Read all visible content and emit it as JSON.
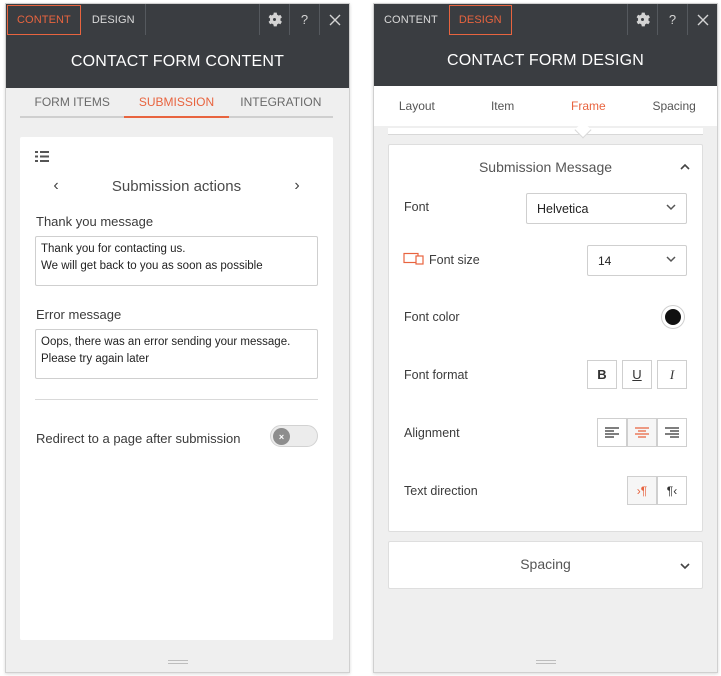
{
  "left": {
    "tabs": [
      "CONTENT",
      "DESIGN"
    ],
    "title": "CONTACT FORM CONTENT",
    "subtabs": [
      "FORM ITEMS",
      "SUBMISSION",
      "INTEGRATION"
    ],
    "section_nav": "Submission actions",
    "thank_label": "Thank you message",
    "thank_line1": "Thank you for contacting us.",
    "thank_line2": "We will get back to you as soon as possible",
    "error_label": "Error message",
    "error_line1": "Oops, there was an error sending your message.",
    "error_line2": "Please try again later",
    "redirect_label": "Redirect to a page after submission"
  },
  "right": {
    "tabs": [
      "CONTENT",
      "DESIGN"
    ],
    "title": "CONTACT FORM DESIGN",
    "subtabs": [
      "Layout",
      "Item",
      "Frame",
      "Spacing"
    ],
    "section_title": "Submission Message",
    "font_label": "Font",
    "font_value": "Helvetica",
    "font_size_label": "Font size",
    "font_size_value": "14",
    "font_color_label": "Font color",
    "font_color": "#111111",
    "font_format_label": "Font format",
    "format_bold": "B",
    "format_underline": "U",
    "format_italic": "I",
    "alignment_label": "Alignment",
    "text_direction_label": "Text direction",
    "spacing_section": "Spacing"
  },
  "colors": {
    "accent": "#e8643f",
    "header": "#3a3d41"
  }
}
